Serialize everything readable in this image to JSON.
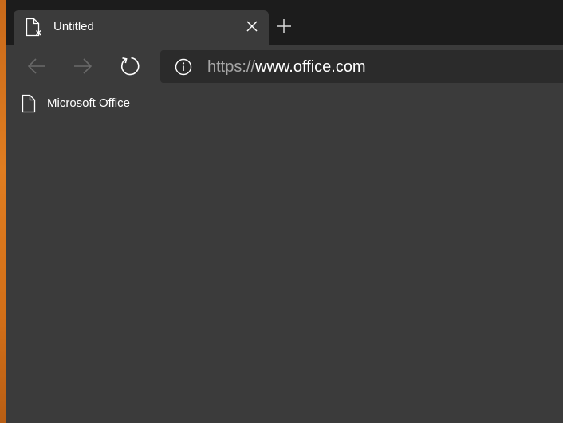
{
  "tab": {
    "title": "Untitled",
    "favicon": "page-error-icon",
    "close": "close-icon"
  },
  "tabstrip": {
    "new_tab": "plus-icon"
  },
  "toolbar": {
    "back": "arrow-left-icon",
    "forward": "arrow-right-icon",
    "refresh": "refresh-icon"
  },
  "address": {
    "info": "info-icon",
    "scheme": "https://",
    "host": "www.office.com"
  },
  "favorites": {
    "items": [
      {
        "label": "Microsoft Office",
        "icon": "page-icon"
      }
    ]
  },
  "colors": {
    "tabstrip_bg": "#1c1c1c",
    "chrome_bg": "#3b3b3b",
    "address_bg": "#2b2b2b",
    "scheme_text": "#a6a6a6",
    "text": "#ffffff",
    "desktop_accent": "#e07d20"
  }
}
